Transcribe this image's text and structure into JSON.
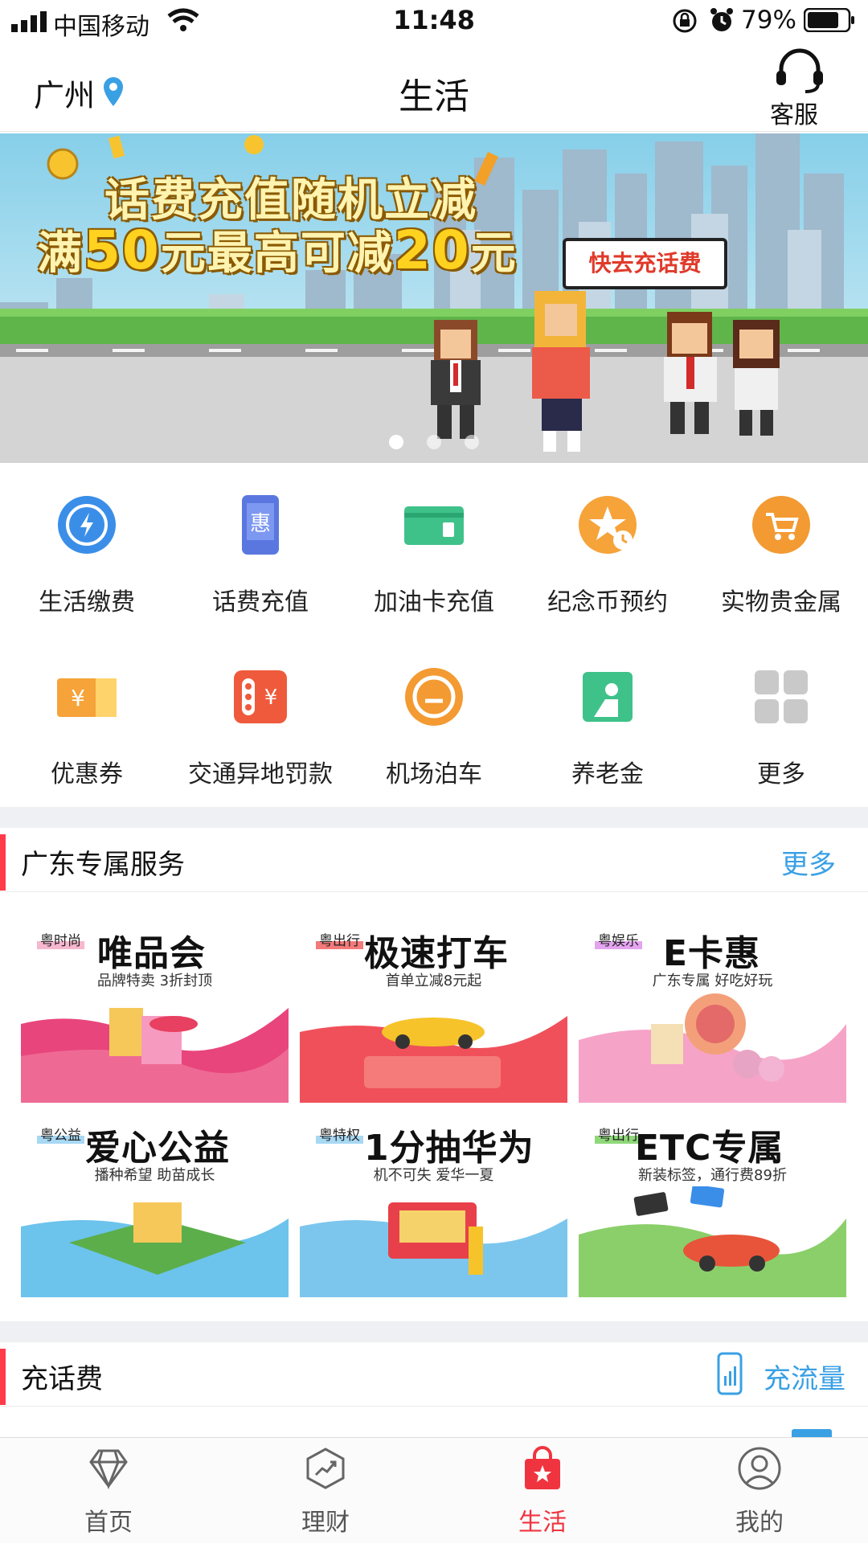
{
  "status_bar": {
    "carrier": "中国移动",
    "time": "11:48",
    "battery": "79%"
  },
  "header": {
    "city": "广州",
    "title": "生活",
    "service_label": "客服"
  },
  "banner": {
    "line1": "话费充值随机立减",
    "line2_a": "满",
    "line2_b": "50",
    "line2_c": "元最高可减",
    "line2_d": "20",
    "line2_e": "元",
    "bubble": "快去充话费",
    "dots": 3,
    "active_dot": 0
  },
  "services": [
    {
      "label": "生活缴费",
      "icon": "lightning-icon"
    },
    {
      "label": "话费充值",
      "icon": "phone-discount-icon",
      "glyph": "惠"
    },
    {
      "label": "加油卡充值",
      "icon": "fuel-card-icon"
    },
    {
      "label": "纪念币预约",
      "icon": "star-clock-icon"
    },
    {
      "label": "实物贵金属",
      "icon": "cart-icon"
    },
    {
      "label": "优惠券",
      "icon": "coupon-icon",
      "glyph": "¥"
    },
    {
      "label": "交通异地罚款",
      "icon": "traffic-fine-icon",
      "glyph": "¥"
    },
    {
      "label": "机场泊车",
      "icon": "parking-icon"
    },
    {
      "label": "养老金",
      "icon": "pension-icon"
    },
    {
      "label": "更多",
      "icon": "more-grid-icon"
    }
  ],
  "guangdong_section": {
    "title": "广东专属服务",
    "more": "更多"
  },
  "promos": [
    {
      "tag": "粤时尚",
      "title": "唯品会",
      "subtitle": "品牌特卖  3折封顶",
      "color": "#e8457c"
    },
    {
      "tag": "粤出行",
      "title": "极速打车",
      "subtitle": "首单立减8元起",
      "color": "#f0505a"
    },
    {
      "tag": "粤娱乐",
      "title": "E卡惠",
      "subtitle": "广东专属  好吃好玩",
      "color": "#f6a3c8"
    },
    {
      "tag": "粤公益",
      "title": "爱心公益",
      "subtitle": "播种希望  助苗成长",
      "color": "#6cc3ec"
    },
    {
      "tag": "粤特权",
      "title": "1分抽华为",
      "subtitle": "机不可失  爱华一夏",
      "color": "#7cc6ee"
    },
    {
      "tag": "粤出行",
      "title": "ETC专属",
      "subtitle": "新装标签，通行费89折",
      "color": "#8bcf6a"
    }
  ],
  "recharge_section": {
    "title": "充话费",
    "right_link": "充流量"
  },
  "tabs": [
    {
      "label": "首页",
      "icon": "diamond-icon"
    },
    {
      "label": "理财",
      "icon": "chart-up-icon"
    },
    {
      "label": "生活",
      "icon": "shopping-bag-star-icon"
    },
    {
      "label": "我的",
      "icon": "user-icon"
    }
  ],
  "active_tab": 2,
  "colors": {
    "accent": "#f0343f",
    "link": "#3aa0e4",
    "section_bar": "#ff3b4a"
  }
}
